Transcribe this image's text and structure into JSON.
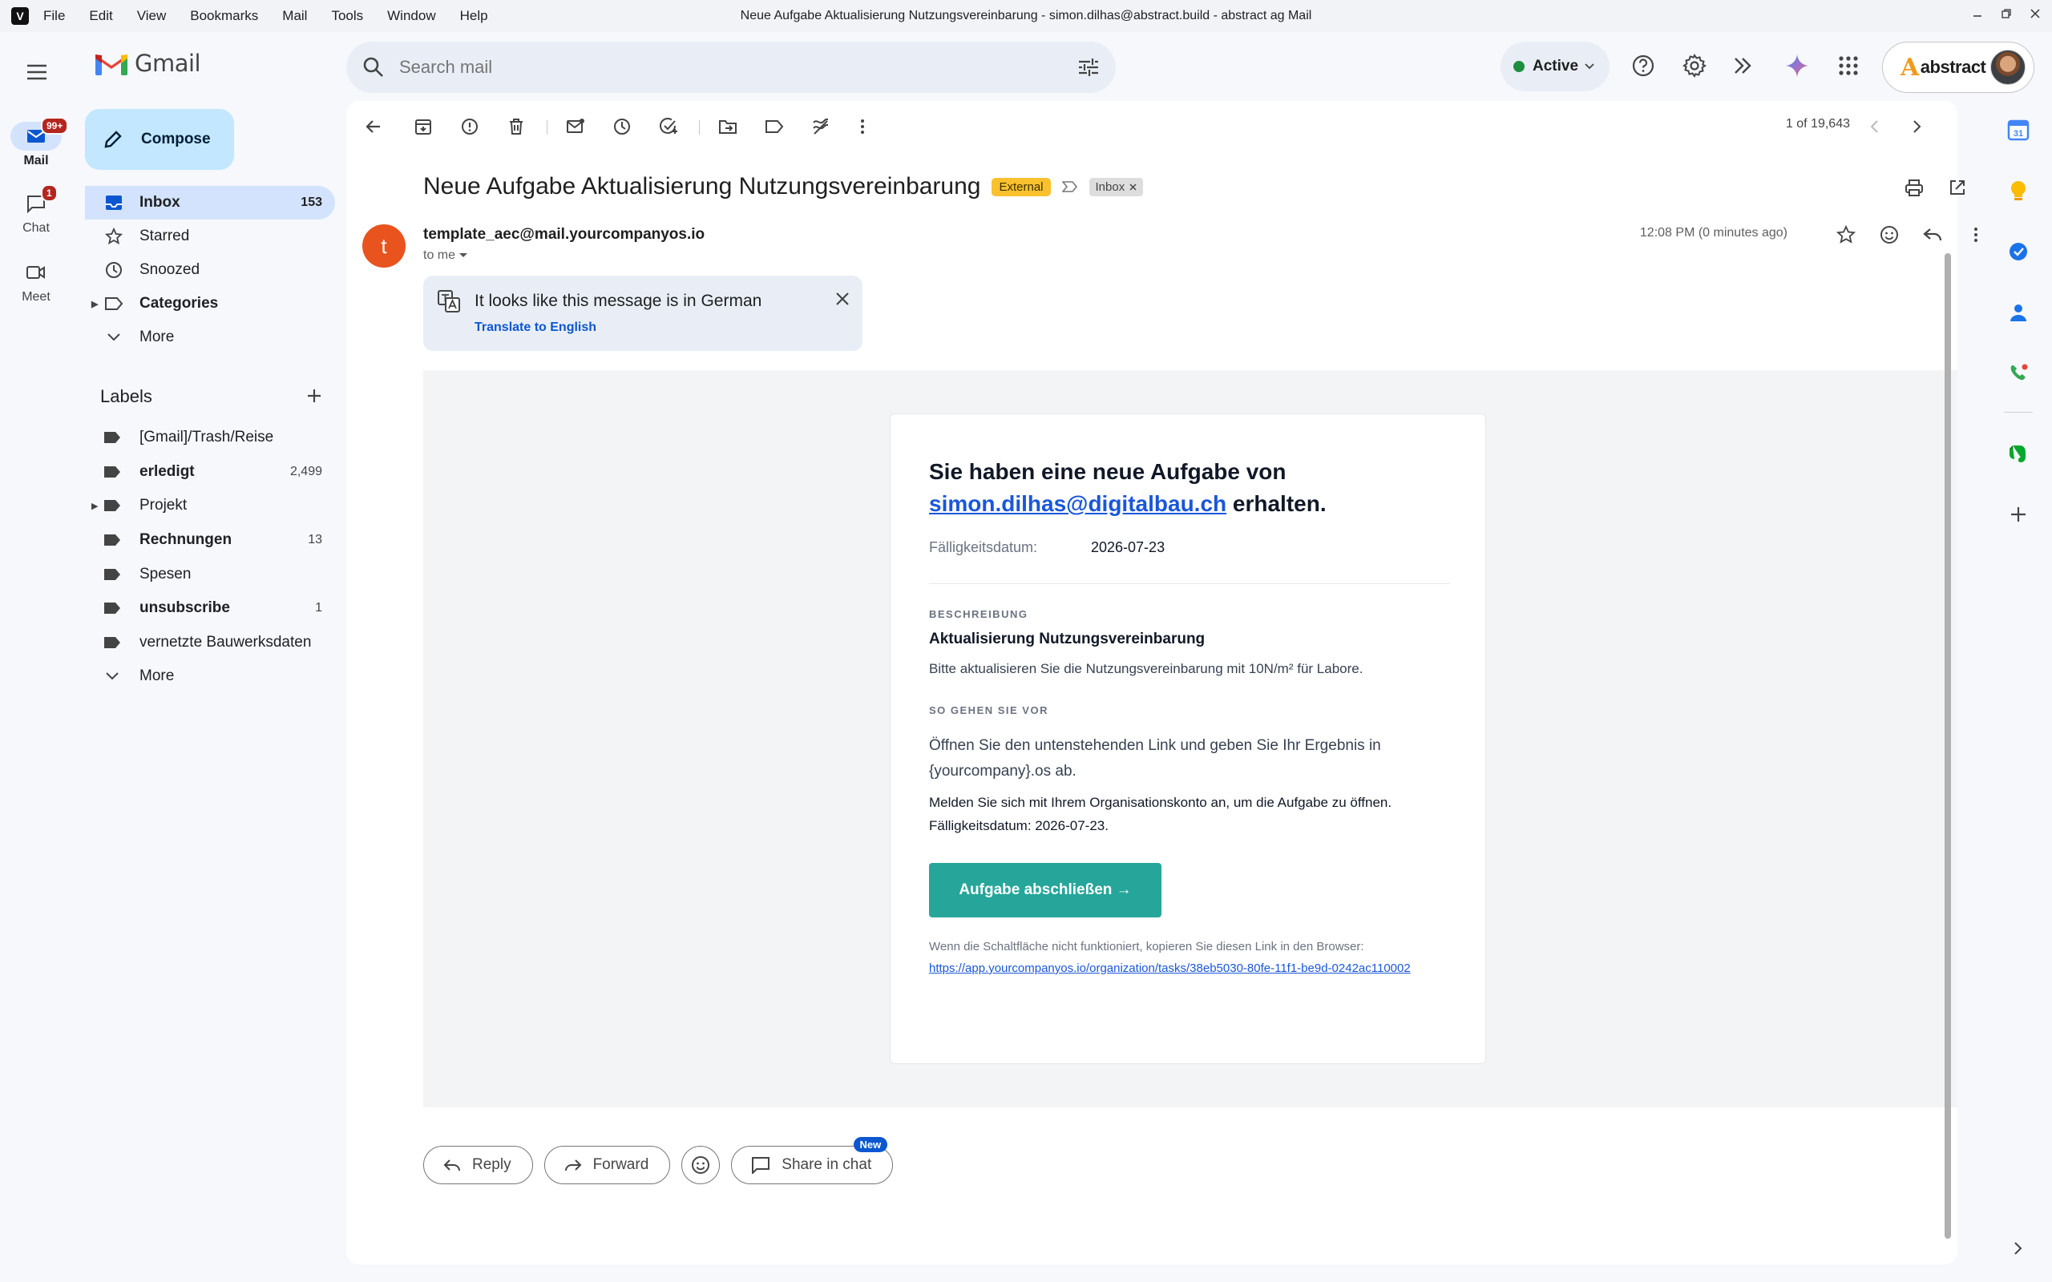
{
  "os": {
    "app_logo": "V",
    "menu": [
      "File",
      "Edit",
      "View",
      "Bookmarks",
      "Mail",
      "Tools",
      "Window",
      "Help"
    ],
    "window_title": "Neue Aufgabe Aktualisierung Nutzungsvereinbarung - simon.dilhas@abstract.build - abstract ag Mail"
  },
  "rail": {
    "mail_label": "Mail",
    "mail_badge": "99+",
    "chat_label": "Chat",
    "chat_badge": "1",
    "meet_label": "Meet"
  },
  "header": {
    "product_name": "Gmail",
    "search_placeholder": "Search mail",
    "status_label": "Active",
    "account_brand": "abstract"
  },
  "sidebar": {
    "compose_label": "Compose",
    "nav": [
      {
        "label": "Inbox",
        "count": "153",
        "icon": "inbox-icon"
      },
      {
        "label": "Starred",
        "count": "",
        "icon": "star-icon"
      },
      {
        "label": "Snoozed",
        "count": "",
        "icon": "clock-icon"
      },
      {
        "label": "Categories",
        "count": "",
        "icon": "label-outline-icon"
      },
      {
        "label": "More",
        "count": "",
        "icon": "chevron-down-icon"
      }
    ],
    "labels_title": "Labels",
    "labels": [
      {
        "label": "[Gmail]/Trash/Reise",
        "count": ""
      },
      {
        "label": "erledigt",
        "count": "2,499"
      },
      {
        "label": "Projekt",
        "count": ""
      },
      {
        "label": "Rechnungen",
        "count": "13"
      },
      {
        "label": "Spesen",
        "count": ""
      },
      {
        "label": "unsubscribe",
        "count": "1"
      },
      {
        "label": "vernetzte Bauwerksdaten",
        "count": ""
      },
      {
        "label": "More",
        "count": ""
      }
    ]
  },
  "toolbar": {
    "pager": "1 of 19,643"
  },
  "message": {
    "subject": "Neue Aufgabe Aktualisierung Nutzungsvereinbarung",
    "external_badge": "External",
    "inbox_chip": "Inbox",
    "sender_initial": "t",
    "sender": "template_aec@mail.yourcompanyos.io",
    "to": "to me",
    "time": "12:08 PM (0 minutes ago)",
    "translate_notice": "It looks like this message is in German",
    "translate_link": "Translate to English"
  },
  "email": {
    "heading_pre": "Sie haben eine neue Aufgabe von",
    "heading_link": "simon.dilhas@digitalbau.ch",
    "heading_post": " erhalten.",
    "due_label": "Fälligkeitsdatum:",
    "due_value": "2026-07-23",
    "desc_section": "BESCHREIBUNG",
    "task_title": "Aktualisierung Nutzungsvereinbarung",
    "task_desc": "Bitte aktualisieren Sie die Nutzungsvereinbarung mit 10N/m² für Labore.",
    "steps_section": "SO GEHEN SIE VOR",
    "steps_1": "Öffnen Sie den untenstehenden Link und geben Sie Ihr Ergebnis in {yourcompany}.os ab.",
    "steps_2": "Melden Sie sich mit Ihrem Organisationskonto an, um die Aufgabe zu öffnen. Fälligkeitsdatum: 2026-07-23.",
    "cta_label": "Aufgabe abschließen →",
    "fallback_text": "Wenn die Schaltfläche nicht funktioniert, kopieren Sie diesen Link in den Browser:",
    "fallback_link": "https://app.yourcompanyos.io/organization/tasks/38eb5030-80fe-11f1-be9d-0242ac110002"
  },
  "actions": {
    "reply": "Reply",
    "forward": "Forward",
    "share": "Share in chat",
    "new_badge": "New"
  },
  "side_panel": {
    "calendar_day": "31"
  }
}
